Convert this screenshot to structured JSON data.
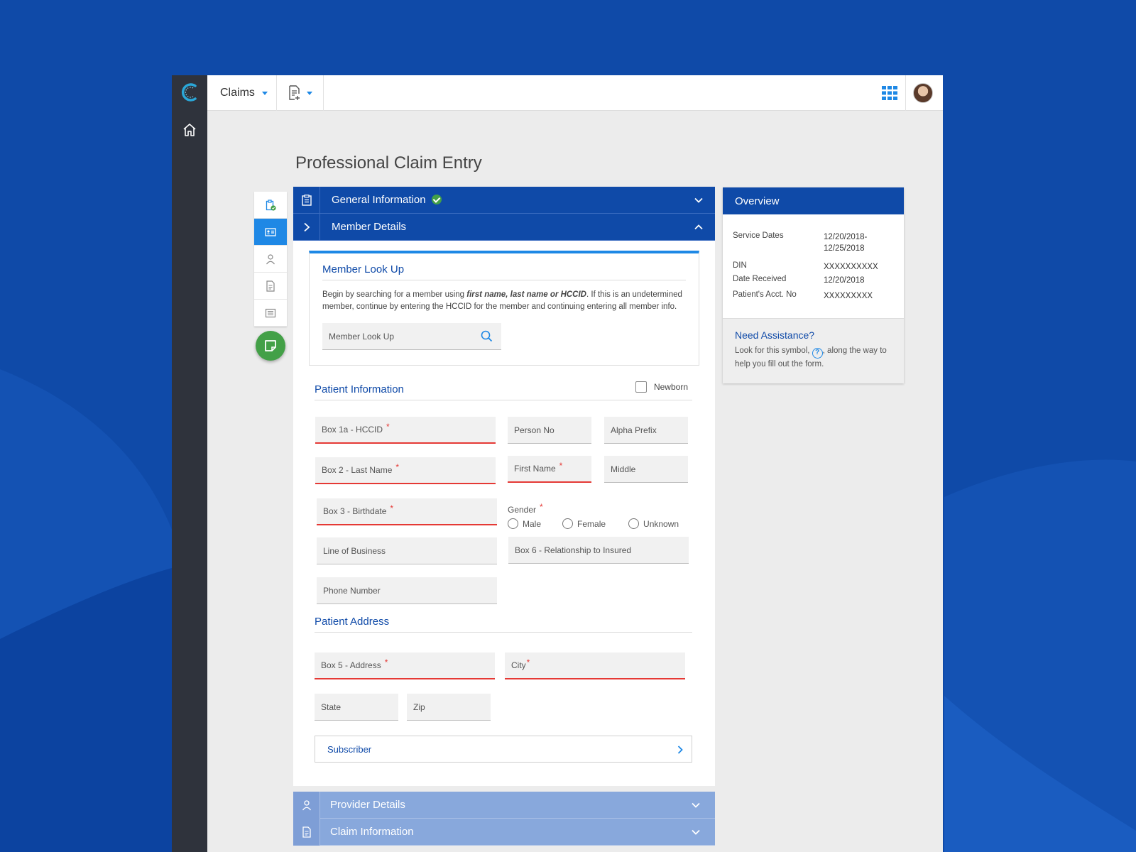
{
  "header": {
    "module_label": "Claims",
    "icons": {
      "logo": "logo-c-icon",
      "home": "home-icon",
      "new_doc": "new-document-icon",
      "apps": "app-grid-icon"
    }
  },
  "page": {
    "title": "Professional Claim Entry"
  },
  "steps": [
    {
      "icon": "clipboard-check-icon",
      "active": false
    },
    {
      "icon": "id-card-icon",
      "active": true
    },
    {
      "icon": "person-icon",
      "active": false
    },
    {
      "icon": "document-icon",
      "active": false
    },
    {
      "icon": "list-icon",
      "active": false
    }
  ],
  "sections": {
    "general": {
      "label": "General Information",
      "complete": true
    },
    "member": {
      "label": "Member Details",
      "expanded": true
    },
    "provider": {
      "label": "Provider Details"
    },
    "claim": {
      "label": "Claim Information"
    }
  },
  "member_lookup": {
    "title": "Member Look Up",
    "desc_prefix": "Begin by searching for a member using ",
    "desc_bold": "first name, last name or HCCID",
    "desc_suffix": ". If this is an undetermined member, continue by entering the HCCID for the member and continuing entering all member info.",
    "placeholder": "Member Look Up"
  },
  "patient_info": {
    "title": "Patient Information",
    "newborn_label": "Newborn",
    "fields": {
      "hccid": "Box 1a - HCCID",
      "person_no": "Person No",
      "alpha_prefix": "Alpha Prefix",
      "last_name": "Box 2 - Last Name",
      "first_name": "First Name",
      "middle": "Middle",
      "birthdate": "Box 3 - Birthdate",
      "line_of_business": "Line of Business",
      "relationship": "Box 6 - Relationship to Insured",
      "phone": "Phone Number"
    },
    "gender": {
      "label": "Gender",
      "options": [
        "Male",
        "Female",
        "Unknown"
      ]
    }
  },
  "patient_address": {
    "title": "Patient Address",
    "fields": {
      "address": "Box 5 - Address",
      "city": "City",
      "state": "State",
      "zip": "Zip"
    }
  },
  "subscriber": {
    "label": "Subscriber"
  },
  "overview": {
    "title": "Overview",
    "rows": [
      {
        "k": "Service Dates",
        "v": "12/20/2018-",
        "v2": "12/25/2018"
      },
      {
        "k": "DIN",
        "v": "XXXXXXXXXX"
      },
      {
        "k": "Date Received",
        "v": "12/20/2018"
      },
      {
        "k": "Patient's Acct. No",
        "v": "XXXXXXXXX"
      }
    ],
    "assist_title": "Need Assistance?",
    "assist_text_1": "Look for this symbol, ",
    "assist_text_2": ", along the way to help you fill out the form."
  },
  "colors": {
    "brand": "#0f4aa8",
    "accent": "#1e88e5",
    "success": "#43a047",
    "required": "#e53935",
    "rail": "#2f333c"
  }
}
